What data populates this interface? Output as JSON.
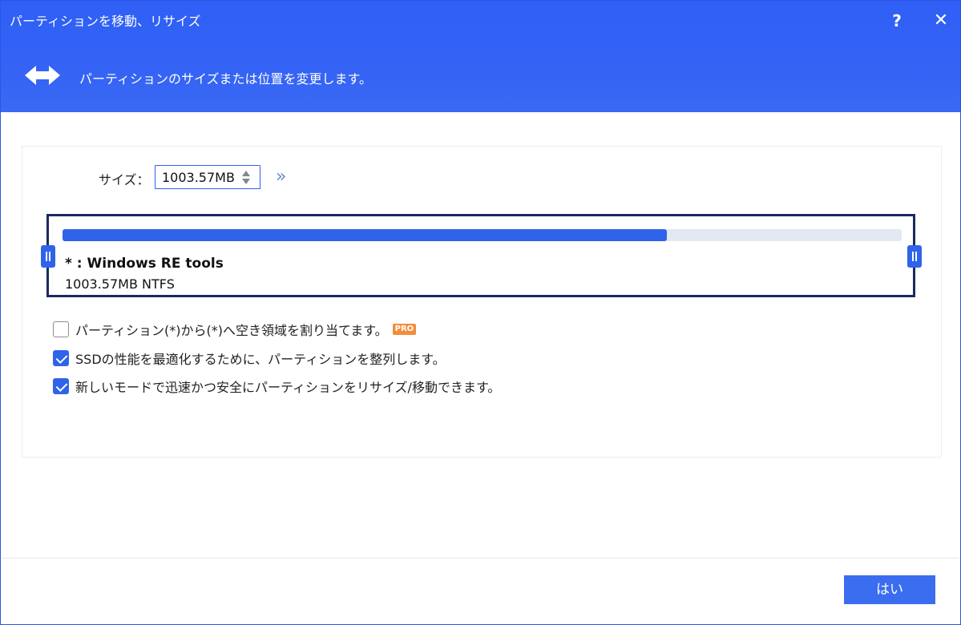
{
  "window": {
    "title": "パーティションを移動、リサイズ",
    "help_label": "?",
    "close_label": "✕"
  },
  "banner": {
    "icon": "double-arrow-icon",
    "text": "パーティションのサイズまたは位置を変更します。"
  },
  "size": {
    "label": "サイズ：",
    "value": "1003.57MB"
  },
  "partition": {
    "name": "* : Windows RE tools",
    "info": "1003.57MB NTFS",
    "used_fraction": 0.72,
    "bar_color": "#2e63ea"
  },
  "options": [
    {
      "label": "パーティション(*)から(*)へ空き領域を割り当てます。",
      "checked": false,
      "badge": "PRO"
    },
    {
      "label": "SSDの性能を最適化するために、パーティションを整列します。",
      "checked": true
    },
    {
      "label": "新しいモードで迅速かつ安全にパーティションをリサイズ/移動できます。",
      "checked": true
    }
  ],
  "footer": {
    "ok_label": "はい"
  },
  "colors": {
    "accent": "#2f5ff5",
    "badge": "#f28d3c"
  }
}
